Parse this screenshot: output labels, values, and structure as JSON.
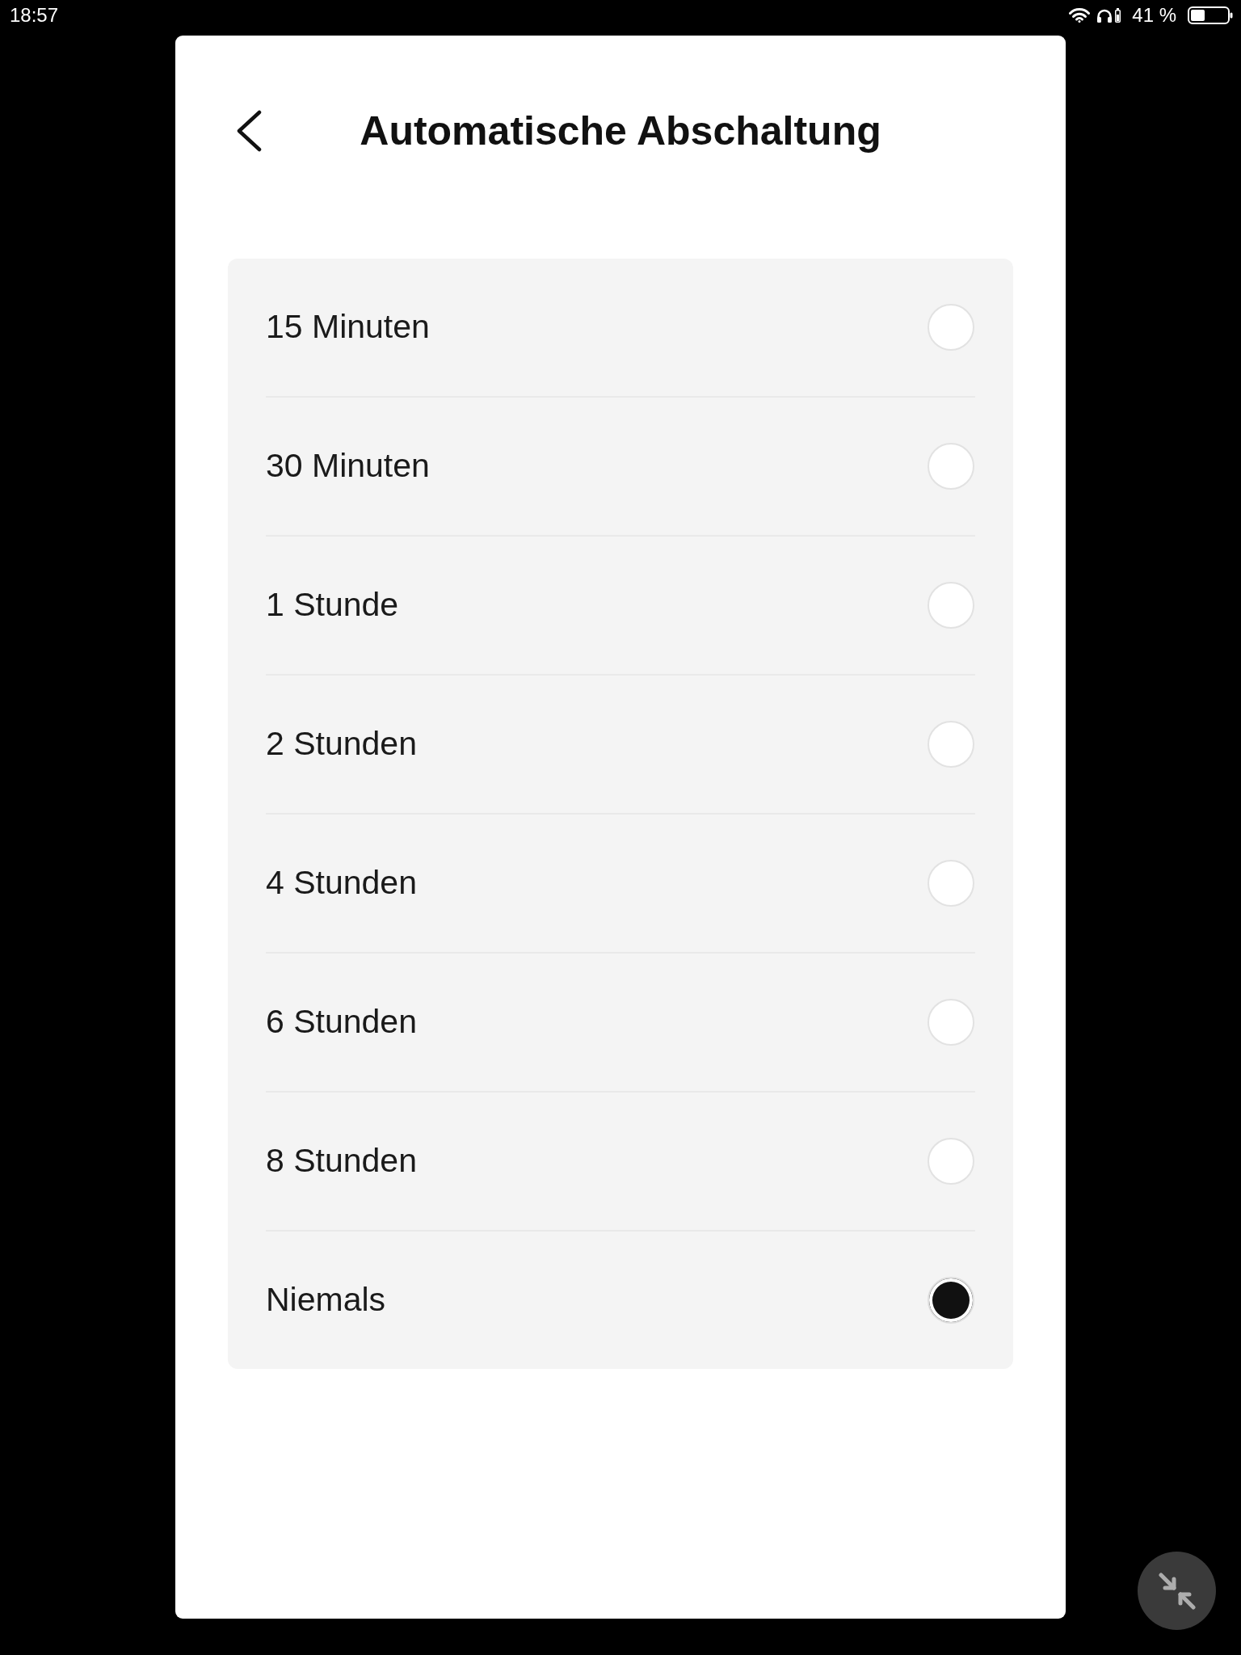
{
  "status_bar": {
    "time": "18:57",
    "battery_text": "41 %"
  },
  "header": {
    "title": "Automatische Abschaltung"
  },
  "options": [
    {
      "label": "15 Minuten",
      "selected": false
    },
    {
      "label": "30 Minuten",
      "selected": false
    },
    {
      "label": "1 Stunde",
      "selected": false
    },
    {
      "label": "2 Stunden",
      "selected": false
    },
    {
      "label": "4 Stunden",
      "selected": false
    },
    {
      "label": "6 Stunden",
      "selected": false
    },
    {
      "label": "8 Stunden",
      "selected": false
    },
    {
      "label": "Niemals",
      "selected": true
    }
  ]
}
